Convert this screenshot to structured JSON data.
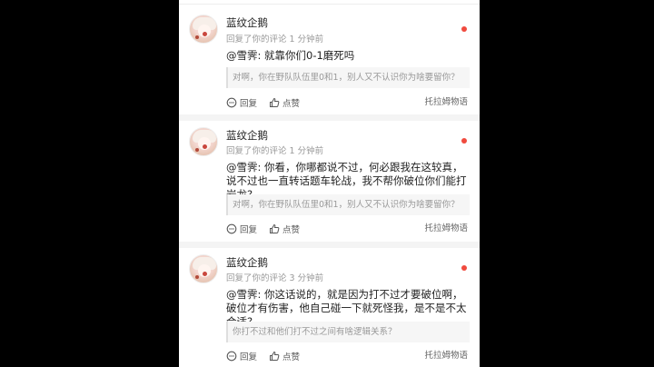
{
  "notifications": [
    {
      "username": "蓝纹企鹅",
      "subline": "回复了你的评论 1 分钟前",
      "content": "@雪霁: 就靠你们0-1磨死吗",
      "quote": "对啊，你在野队队伍里0和1，别人又不认识你为啥要留你？",
      "reply_label": "回复",
      "like_label": "点赞",
      "source": "托拉姆物语"
    },
    {
      "username": "蓝纹企鹅",
      "subline": "回复了你的评论 1 分钟前",
      "content": "@雪霁: 你看，你哪都说不过，何必跟我在这较真，说不过也一直转话题车轮战，我不帮你破位你们能打岩龙?",
      "quote": "对啊，你在野队队伍里0和1，别人又不认识你为啥要留你？",
      "reply_label": "回复",
      "like_label": "点赞",
      "source": "托拉姆物语"
    },
    {
      "username": "蓝纹企鹅",
      "subline": "回复了你的评论 3 分钟前",
      "content": "@雪霁: 你这话说的，就是因为打不过才要破位啊，破位才有伤害，他自己碰一下就死怪我，是不是不太合适?",
      "quote": "你打不过和他们打不过之间有啥逻辑关系？",
      "reply_label": "回复",
      "like_label": "点赞",
      "source": "托拉姆物语"
    }
  ],
  "colors": {
    "unread_dot": "#f04a3e",
    "background_outside": "#000000",
    "card_background": "#ffffff"
  },
  "icons": [
    "comment-icon",
    "thumbs-up-icon",
    "unread-dot"
  ]
}
